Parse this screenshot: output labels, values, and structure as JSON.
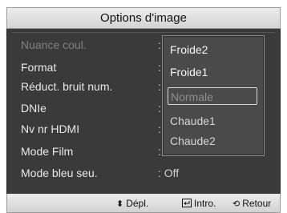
{
  "title": "Options d'image",
  "menu": {
    "items": [
      {
        "label": "Nuance coul.",
        "value": ":",
        "dim": true
      },
      {
        "label": "Format",
        "value": ":"
      },
      {
        "label": "Réduct. bruit num.",
        "value": ":"
      },
      {
        "label": "DNIe",
        "value": ":"
      },
      {
        "label": "Nv nr HDMI",
        "value": ":"
      },
      {
        "label": "Mode Film",
        "value": ":"
      },
      {
        "label": "Mode bleu seu.",
        "value": ": Off"
      }
    ]
  },
  "dropdown": {
    "options": [
      "Froide2",
      "Froide1",
      "Normale",
      "Chaude1",
      "Chaude2"
    ],
    "selected": "Normale"
  },
  "footer": {
    "move_icon": "up-down-arrows-icon",
    "move_label": "Dépl.",
    "enter_icon": "enter-icon",
    "enter_label": "Intro.",
    "return_icon": "return-icon",
    "return_label": "Retour"
  }
}
